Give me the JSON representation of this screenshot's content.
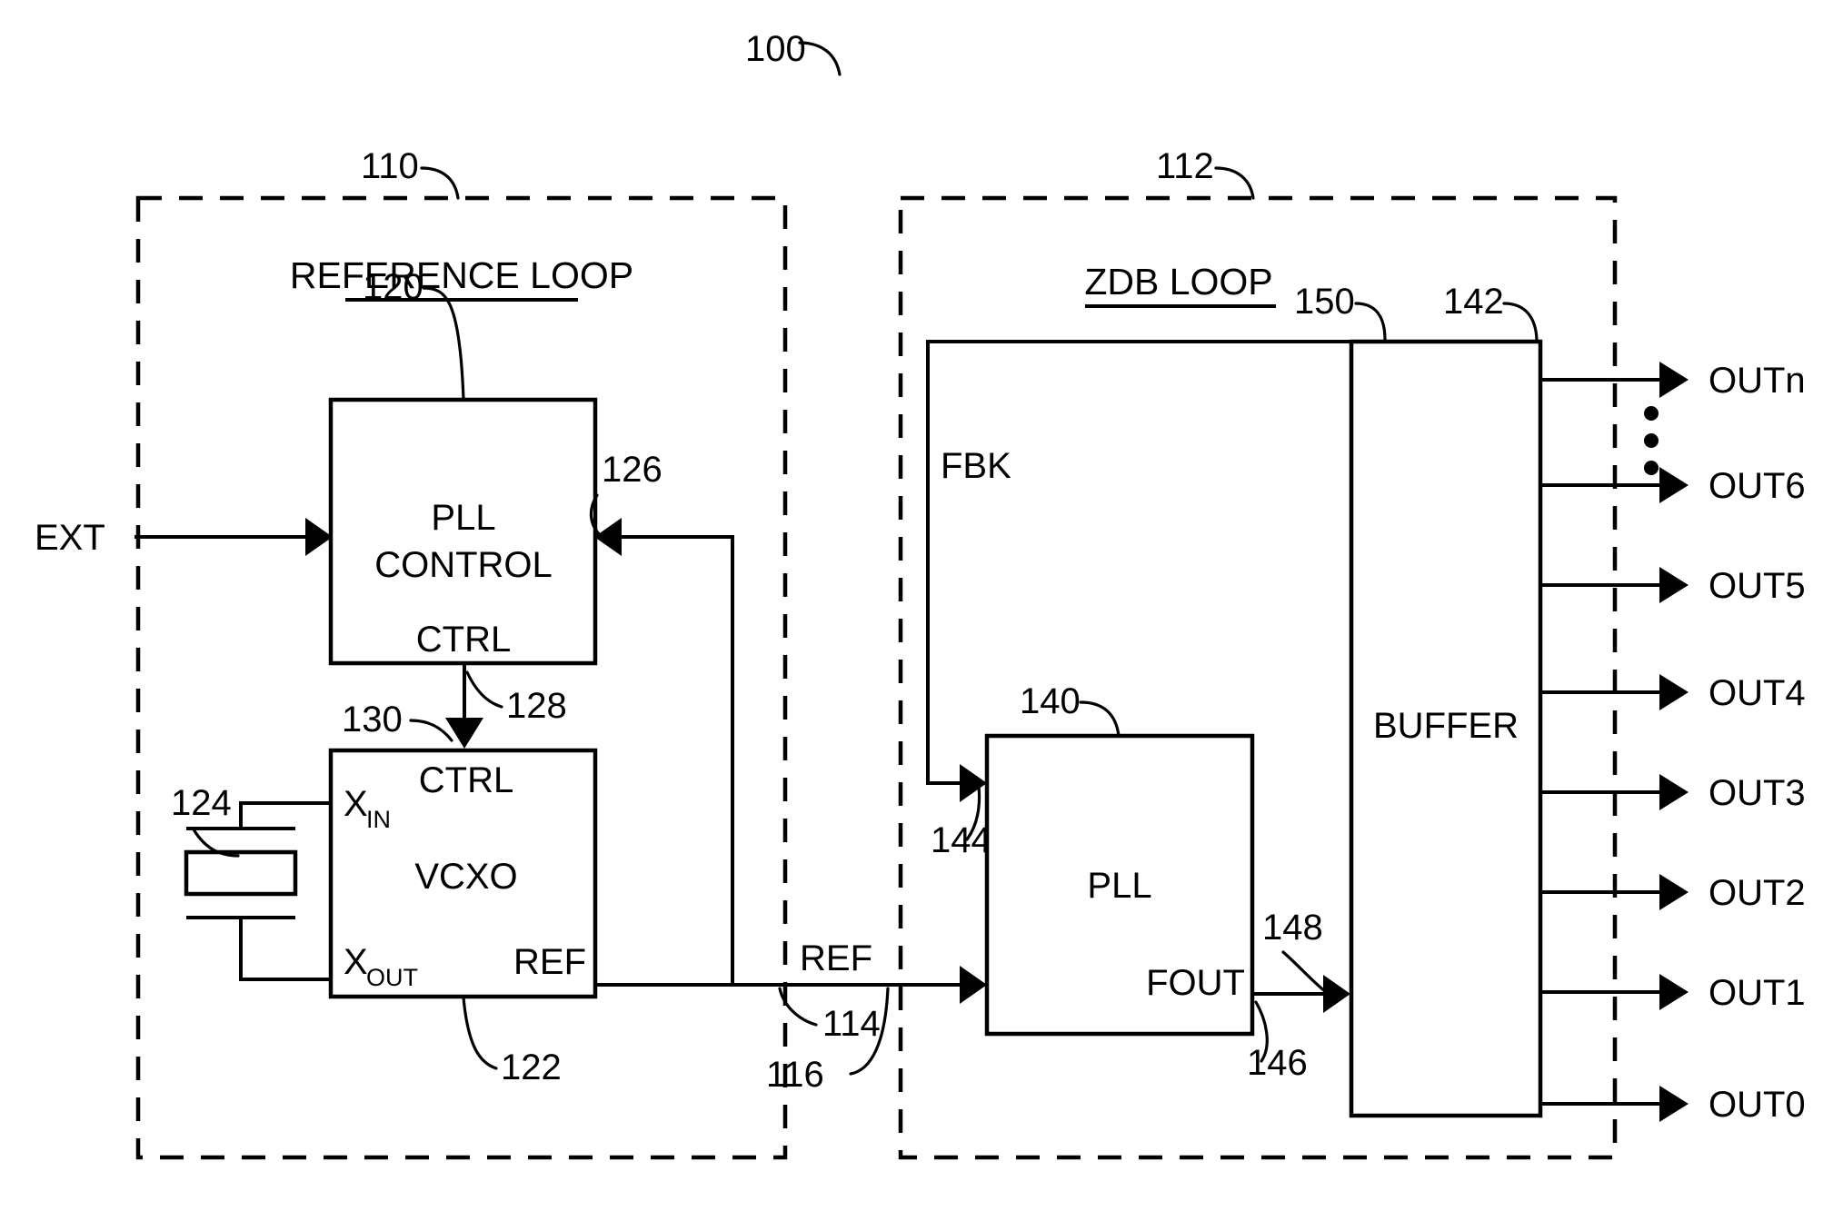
{
  "figure": {
    "label": "100",
    "type": "patent-block-diagram",
    "description": "Clock generator with reference loop and zero delay buffer loop"
  },
  "groups": [
    {
      "id": "reference-loop",
      "ref": "110",
      "title": "REFERENCE LOOP"
    },
    {
      "id": "zdb-loop",
      "ref": "112",
      "title": "ZDB LOOP"
    }
  ],
  "blocks": [
    {
      "id": "pll-control",
      "ref": "120",
      "label_line1": "PLL",
      "label_line2": "CONTROL"
    },
    {
      "id": "vcxo",
      "ref": "122",
      "label": "VCXO"
    },
    {
      "id": "pll",
      "ref": "140",
      "label": "PLL"
    },
    {
      "id": "buffer",
      "ref": "142",
      "label": "BUFFER"
    }
  ],
  "ports": {
    "pll_control_out": "CTRL",
    "vcxo_ctrl_in": "CTRL",
    "vcxo_xin": {
      "base": "X",
      "sub": "IN"
    },
    "vcxo_xout": {
      "base": "X",
      "sub": "OUT"
    },
    "vcxo_ref": "REF",
    "pll_fout": "FOUT",
    "fbk": "FBK"
  },
  "signals": [
    {
      "id": "ext-input",
      "label": "EXT"
    },
    {
      "id": "ref-net",
      "label": "REF"
    }
  ],
  "refs": {
    "crystal": "124",
    "feedback_into_pll_control": "126",
    "ctrl_net": "128",
    "ctrl_arrow": "130",
    "ref_net_a": "114",
    "ref_net_b": "116",
    "pll_fbk_input": "144",
    "fout_net": "146",
    "fout_arrow": "148",
    "buffer_fbk_tap": "150"
  },
  "outputs": [
    {
      "id": "outn",
      "label": "OUTn"
    },
    {
      "id": "out6",
      "label": "OUT6"
    },
    {
      "id": "out5",
      "label": "OUT5"
    },
    {
      "id": "out4",
      "label": "OUT4"
    },
    {
      "id": "out3",
      "label": "OUT3"
    },
    {
      "id": "out2",
      "label": "OUT2"
    },
    {
      "id": "out1",
      "label": "OUT1"
    },
    {
      "id": "out0",
      "label": "OUT0"
    }
  ],
  "colors": {
    "ink": "#000000",
    "paper": "#ffffff"
  }
}
